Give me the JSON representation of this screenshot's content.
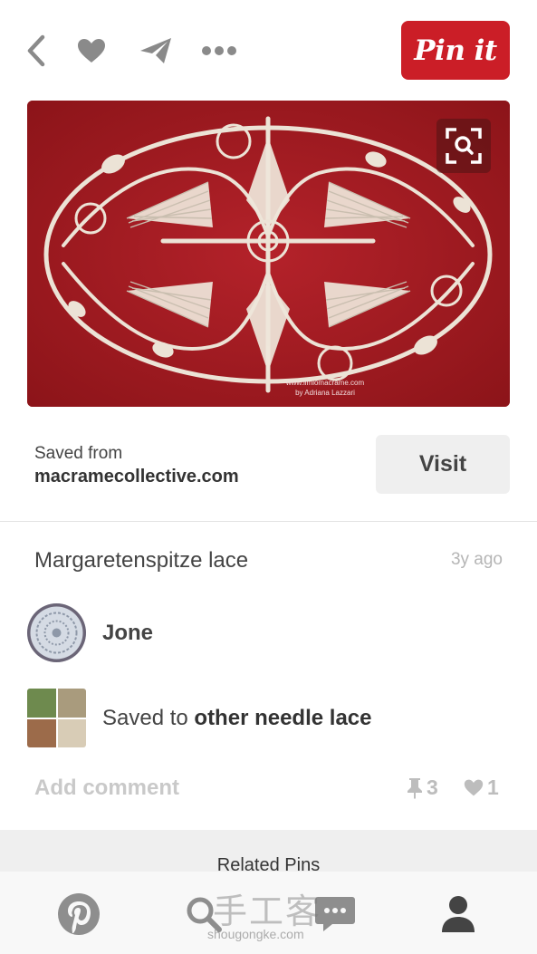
{
  "top_bar": {
    "back_icon": "chevron-left-icon",
    "like_icon": "heart-icon",
    "send_icon": "paper-plane-icon",
    "more_icon": "ellipsis-icon",
    "pin_button_label": "Pin it",
    "accent_color": "#cb1e27"
  },
  "pin_image": {
    "credit_line_1": "www.ilmiomacrame.com",
    "credit_line_2": "by Adriana Lazzari",
    "zoom_icon": "visual-search-icon"
  },
  "source": {
    "label": "Saved from",
    "domain": "macramecollective.com",
    "visit_label": "Visit"
  },
  "pin": {
    "title": "Margaretenspitze lace",
    "age": "3y ago",
    "pinner_name": "Jone",
    "board_prefix": "Saved to",
    "board_name": "other needle lace",
    "add_comment": "Add comment",
    "repin_count": "3",
    "like_count": "1"
  },
  "related": {
    "title": "Related Pins"
  },
  "tab_bar": {
    "tabs": [
      "pinterest-home-icon",
      "search-icon",
      "messages-icon",
      "profile-icon"
    ]
  },
  "watermark": {
    "main": "手工客",
    "sub": "shougongke.com"
  }
}
